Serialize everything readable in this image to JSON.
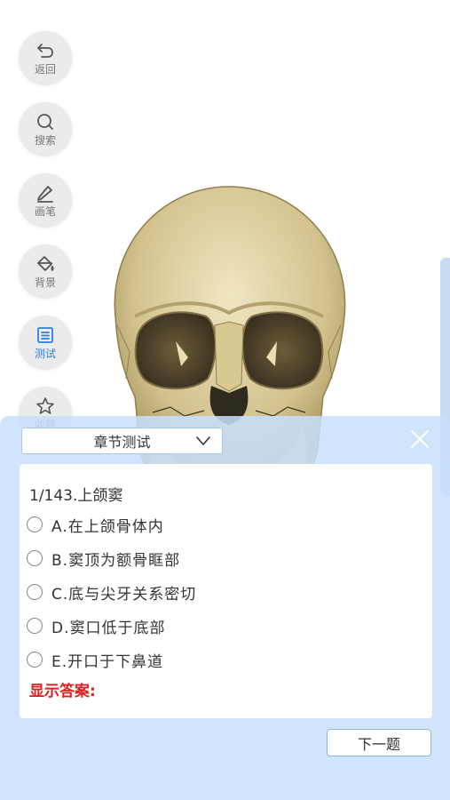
{
  "toolbar": {
    "items": [
      {
        "label": "返回",
        "icon": "back-arrow-icon"
      },
      {
        "label": "搜索",
        "icon": "search-icon"
      },
      {
        "label": "画笔",
        "icon": "pen-icon"
      },
      {
        "label": "背景",
        "icon": "paint-bucket-icon"
      },
      {
        "label": "测试",
        "icon": "test-list-icon",
        "active": true
      },
      {
        "label": "收藏",
        "icon": "star-icon"
      }
    ]
  },
  "quiz": {
    "chapter_select": "章节测试",
    "question": "1/143.上颌窦",
    "options": [
      "A.在上颌骨体内",
      "B.窦顶为额骨眶部",
      "C.底与尖牙关系密切",
      "D.窦口低于底部",
      "E.开口于下鼻道"
    ],
    "answer_label": "显示答案:",
    "next_button": "下一题"
  },
  "colors": {
    "panel": "#c8e0fa",
    "accent": "#2f7fd6",
    "answer": "#e02020"
  }
}
